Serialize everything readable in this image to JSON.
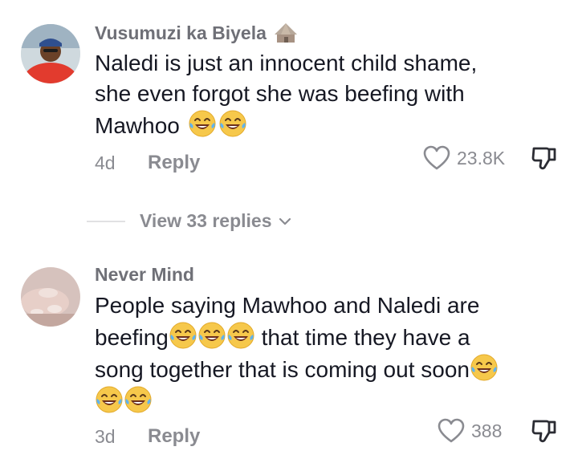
{
  "comments": [
    {
      "username": "Vusumuzi ka Biyela",
      "username_icon": "hut-icon",
      "lines": [
        "Naledi is just an innocent child shame,",
        "she even forgot she was beefing with",
        "Mawhoo"
      ],
      "emojis_line3": [
        "joy-emoji",
        "joy-emoji"
      ],
      "time": "4d",
      "reply_label": "Reply",
      "likes": "23.8K"
    },
    {
      "username": "Never Mind",
      "lines": [
        "People saying Mawhoo and Naledi are",
        "beefing",
        " that time they have a",
        "song together that is coming out soon"
      ],
      "time": "3d",
      "reply_label": "Reply",
      "likes": "388"
    }
  ],
  "view_replies": {
    "label": "View 33 replies",
    "icon": "chevron-down-icon"
  },
  "colors": {
    "text": "#161823",
    "muted": "#8a8b91",
    "username": "#6f7077"
  }
}
